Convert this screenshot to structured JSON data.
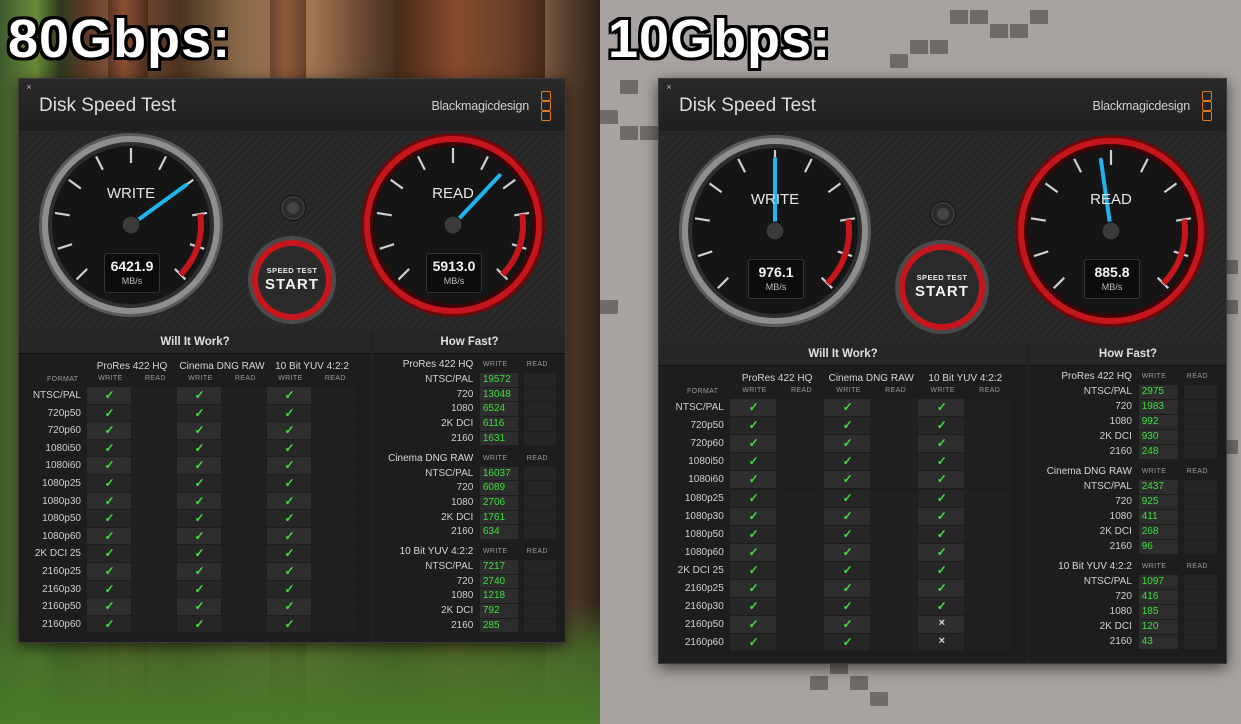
{
  "overlay_labels": {
    "left": "80Gbps:",
    "right": "10Gbps:"
  },
  "colors": {
    "accent_red": "#c4161c",
    "needle_blue": "#1fb4ec",
    "check_green": "#3de03d",
    "brand_orange": "#e07a1a"
  },
  "windows": [
    {
      "id": "w80",
      "title": "Disk Speed Test",
      "brand": "Blackmagicdesign",
      "close_icon": "×",
      "write": {
        "label": "WRITE",
        "value": "6421.9",
        "unit": "MB/s",
        "fraction": 0.7
      },
      "read": {
        "label": "READ",
        "value": "5913.0",
        "unit": "MB/s",
        "fraction": 0.66
      },
      "start": {
        "top": "SPEED TEST",
        "label": "START"
      },
      "will_it_work": {
        "title": "Will It Work?",
        "format_header": "FORMAT",
        "groups": [
          {
            "name": "ProRes 422 HQ",
            "write": "WRITE",
            "read": "READ"
          },
          {
            "name": "Cinema DNG RAW",
            "write": "WRITE",
            "read": "READ"
          },
          {
            "name": "10 Bit YUV 4:2:2",
            "write": "WRITE",
            "read": "READ"
          }
        ],
        "rows": [
          {
            "format": "NTSC/PAL",
            "marks": [
              "✓",
              "✓",
              "✓"
            ]
          },
          {
            "format": "720p50",
            "marks": [
              "✓",
              "✓",
              "✓"
            ]
          },
          {
            "format": "720p60",
            "marks": [
              "✓",
              "✓",
              "✓"
            ]
          },
          {
            "format": "1080i50",
            "marks": [
              "✓",
              "✓",
              "✓"
            ]
          },
          {
            "format": "1080i60",
            "marks": [
              "✓",
              "✓",
              "✓"
            ]
          },
          {
            "format": "1080p25",
            "marks": [
              "✓",
              "✓",
              "✓"
            ]
          },
          {
            "format": "1080p30",
            "marks": [
              "✓",
              "✓",
              "✓"
            ]
          },
          {
            "format": "1080p50",
            "marks": [
              "✓",
              "✓",
              "✓"
            ]
          },
          {
            "format": "1080p60",
            "marks": [
              "✓",
              "✓",
              "✓"
            ]
          },
          {
            "format": "2K DCI 25",
            "marks": [
              "✓",
              "✓",
              "✓"
            ]
          },
          {
            "format": "2160p25",
            "marks": [
              "✓",
              "✓",
              "✓"
            ]
          },
          {
            "format": "2160p30",
            "marks": [
              "✓",
              "✓",
              "✓"
            ]
          },
          {
            "format": "2160p50",
            "marks": [
              "✓",
              "✓",
              "✓"
            ]
          },
          {
            "format": "2160p60",
            "marks": [
              "✓",
              "✓",
              "✓"
            ]
          }
        ]
      },
      "how_fast": {
        "title": "How Fast?",
        "groups": [
          {
            "name": "ProRes 422 HQ",
            "write": "WRITE",
            "read": "READ",
            "rows": [
              {
                "label": "NTSC/PAL",
                "value": "19572"
              },
              {
                "label": "720",
                "value": "13048"
              },
              {
                "label": "1080",
                "value": "6524"
              },
              {
                "label": "2K DCI",
                "value": "6116"
              },
              {
                "label": "2160",
                "value": "1631"
              }
            ]
          },
          {
            "name": "Cinema DNG RAW",
            "write": "WRITE",
            "read": "READ",
            "rows": [
              {
                "label": "NTSC/PAL",
                "value": "16037"
              },
              {
                "label": "720",
                "value": "6089"
              },
              {
                "label": "1080",
                "value": "2706"
              },
              {
                "label": "2K DCI",
                "value": "1761"
              },
              {
                "label": "2160",
                "value": "634"
              }
            ]
          },
          {
            "name": "10 Bit YUV 4:2:2",
            "write": "WRITE",
            "read": "READ",
            "rows": [
              {
                "label": "NTSC/PAL",
                "value": "7217"
              },
              {
                "label": "720",
                "value": "2740"
              },
              {
                "label": "1080",
                "value": "1218"
              },
              {
                "label": "2K DCI",
                "value": "792"
              },
              {
                "label": "2160",
                "value": "285"
              }
            ]
          }
        ]
      }
    },
    {
      "id": "w10",
      "title": "Disk Speed Test",
      "brand": "Blackmagicdesign",
      "close_icon": "×",
      "write": {
        "label": "WRITE",
        "value": "976.1",
        "unit": "MB/s",
        "fraction": 0.5
      },
      "read": {
        "label": "READ",
        "value": "885.8",
        "unit": "MB/s",
        "fraction": 0.47
      },
      "start": {
        "top": "SPEED TEST",
        "label": "START"
      },
      "will_it_work": {
        "title": "Will It Work?",
        "format_header": "FORMAT",
        "groups": [
          {
            "name": "ProRes 422 HQ",
            "write": "WRITE",
            "read": "READ"
          },
          {
            "name": "Cinema DNG RAW",
            "write": "WRITE",
            "read": "READ"
          },
          {
            "name": "10 Bit YUV 4:2:2",
            "write": "WRITE",
            "read": "READ"
          }
        ],
        "rows": [
          {
            "format": "NTSC/PAL",
            "marks": [
              "✓",
              "✓",
              "✓"
            ]
          },
          {
            "format": "720p50",
            "marks": [
              "✓",
              "✓",
              "✓"
            ]
          },
          {
            "format": "720p60",
            "marks": [
              "✓",
              "✓",
              "✓"
            ]
          },
          {
            "format": "1080i50",
            "marks": [
              "✓",
              "✓",
              "✓"
            ]
          },
          {
            "format": "1080i60",
            "marks": [
              "✓",
              "✓",
              "✓"
            ]
          },
          {
            "format": "1080p25",
            "marks": [
              "✓",
              "✓",
              "✓"
            ]
          },
          {
            "format": "1080p30",
            "marks": [
              "✓",
              "✓",
              "✓"
            ]
          },
          {
            "format": "1080p50",
            "marks": [
              "✓",
              "✓",
              "✓"
            ]
          },
          {
            "format": "1080p60",
            "marks": [
              "✓",
              "✓",
              "✓"
            ]
          },
          {
            "format": "2K DCI 25",
            "marks": [
              "✓",
              "✓",
              "✓"
            ]
          },
          {
            "format": "2160p25",
            "marks": [
              "✓",
              "✓",
              "✓"
            ]
          },
          {
            "format": "2160p30",
            "marks": [
              "✓",
              "✓",
              "✓"
            ]
          },
          {
            "format": "2160p50",
            "marks": [
              "✓",
              "✓",
              "×"
            ]
          },
          {
            "format": "2160p60",
            "marks": [
              "✓",
              "✓",
              "×"
            ]
          }
        ]
      },
      "how_fast": {
        "title": "How Fast?",
        "groups": [
          {
            "name": "ProRes 422 HQ",
            "write": "WRITE",
            "read": "READ",
            "rows": [
              {
                "label": "NTSC/PAL",
                "value": "2975"
              },
              {
                "label": "720",
                "value": "1983"
              },
              {
                "label": "1080",
                "value": "992"
              },
              {
                "label": "2K DCI",
                "value": "930"
              },
              {
                "label": "2160",
                "value": "248"
              }
            ]
          },
          {
            "name": "Cinema DNG RAW",
            "write": "WRITE",
            "read": "READ",
            "rows": [
              {
                "label": "NTSC/PAL",
                "value": "2437"
              },
              {
                "label": "720",
                "value": "925"
              },
              {
                "label": "1080",
                "value": "411"
              },
              {
                "label": "2K DCI",
                "value": "268"
              },
              {
                "label": "2160",
                "value": "96"
              }
            ]
          },
          {
            "name": "10 Bit YUV 4:2:2",
            "write": "WRITE",
            "read": "READ",
            "rows": [
              {
                "label": "NTSC/PAL",
                "value": "1097"
              },
              {
                "label": "720",
                "value": "416"
              },
              {
                "label": "1080",
                "value": "185"
              },
              {
                "label": "2K DCI",
                "value": "120"
              },
              {
                "label": "2160",
                "value": "43"
              }
            ]
          }
        ]
      }
    }
  ]
}
